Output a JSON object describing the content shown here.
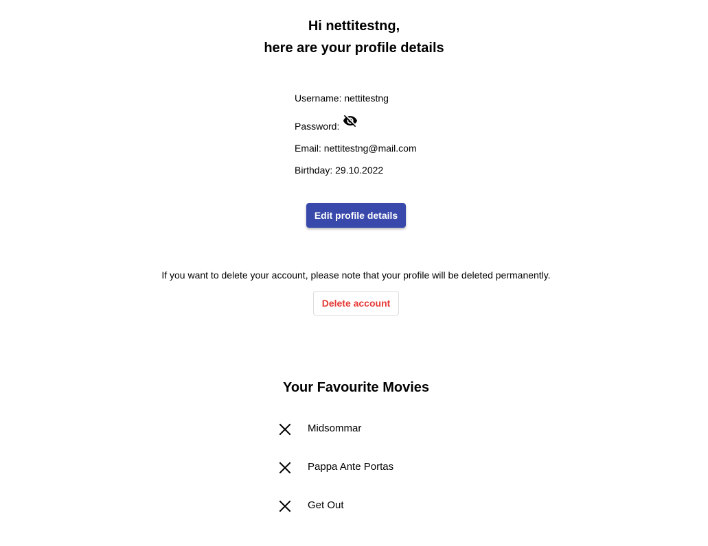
{
  "header": {
    "greeting": "Hi nettitestng,",
    "subtitle": "here are your profile details"
  },
  "profile": {
    "username_label": "Username: nettitestng",
    "password_label": "Password:",
    "email_label": "Email: nettitestng@mail.com",
    "birthday_label": "Birthday: 29.10.2022",
    "password_toggle_icon": "eye-off-icon"
  },
  "actions": {
    "edit_label": "Edit profile details",
    "delete_note": "If you want to delete your account, please note that your profile will be deleted permanently.",
    "delete_label": "Delete account"
  },
  "favourites": {
    "title": "Your Favourite Movies",
    "remove_icon": "close-icon",
    "movies": [
      {
        "title": "Midsommar"
      },
      {
        "title": "Pappa Ante Portas"
      },
      {
        "title": "Get Out"
      }
    ]
  },
  "colors": {
    "primary": "#3949ab",
    "danger": "#e53935"
  }
}
